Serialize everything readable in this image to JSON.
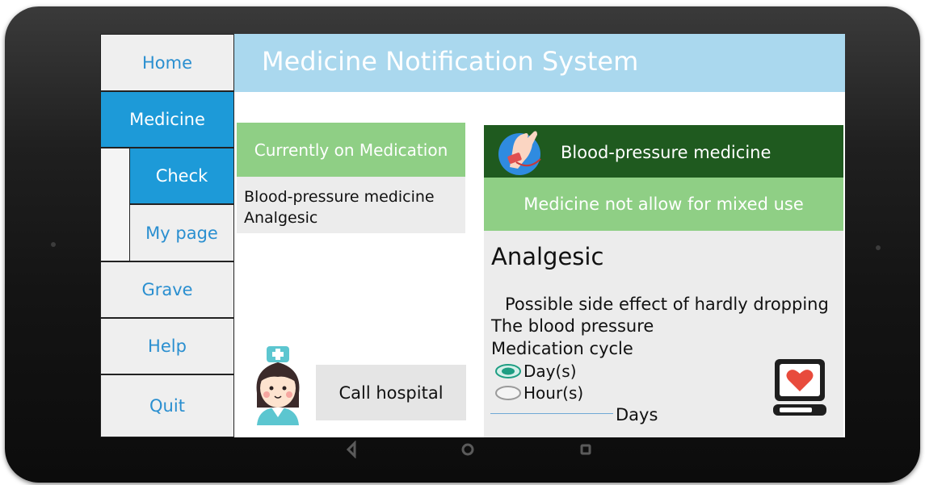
{
  "app": {
    "title": "Medicine Notification System"
  },
  "sidebar": {
    "items": [
      {
        "label": "Home",
        "active": false
      },
      {
        "label": "Medicine",
        "active": true
      },
      {
        "label": "Check",
        "active": true
      },
      {
        "label": "My page",
        "active": false
      },
      {
        "label": "Grave",
        "active": false
      },
      {
        "label": "Help",
        "active": false
      },
      {
        "label": "Quit",
        "active": false
      }
    ]
  },
  "medication": {
    "header": "Currently on Medication",
    "items": [
      "Blood-pressure medicine",
      "Analgesic"
    ]
  },
  "call_hospital": {
    "label": "Call hospital"
  },
  "detail": {
    "title": "Blood-pressure medicine",
    "warning": "Medicine not allow for mixed use",
    "medicine_name": "Analgesic",
    "side_effect_line1": "Possible side effect of hardly dropping",
    "side_effect_line2": "The blood pressure",
    "cycle_label": "Medication cycle",
    "cycle_options": [
      {
        "label": "Day(s)",
        "selected": true
      },
      {
        "label": "Hour(s)",
        "selected": false
      }
    ],
    "cycle_unit": "Days"
  },
  "icons": {
    "medicine_header": "hand-blood-pressure-icon",
    "nurse": "nurse-icon",
    "monitor": "heart-monitor-icon",
    "softkeys": [
      "back-icon",
      "home-icon",
      "recents-icon"
    ]
  },
  "colors": {
    "nav_active": "#1d9ad8",
    "nav_text": "#2a8fd0",
    "header_bg": "#aad8ee",
    "green_light": "#8fcf85",
    "green_dark": "#1f5a1f"
  }
}
